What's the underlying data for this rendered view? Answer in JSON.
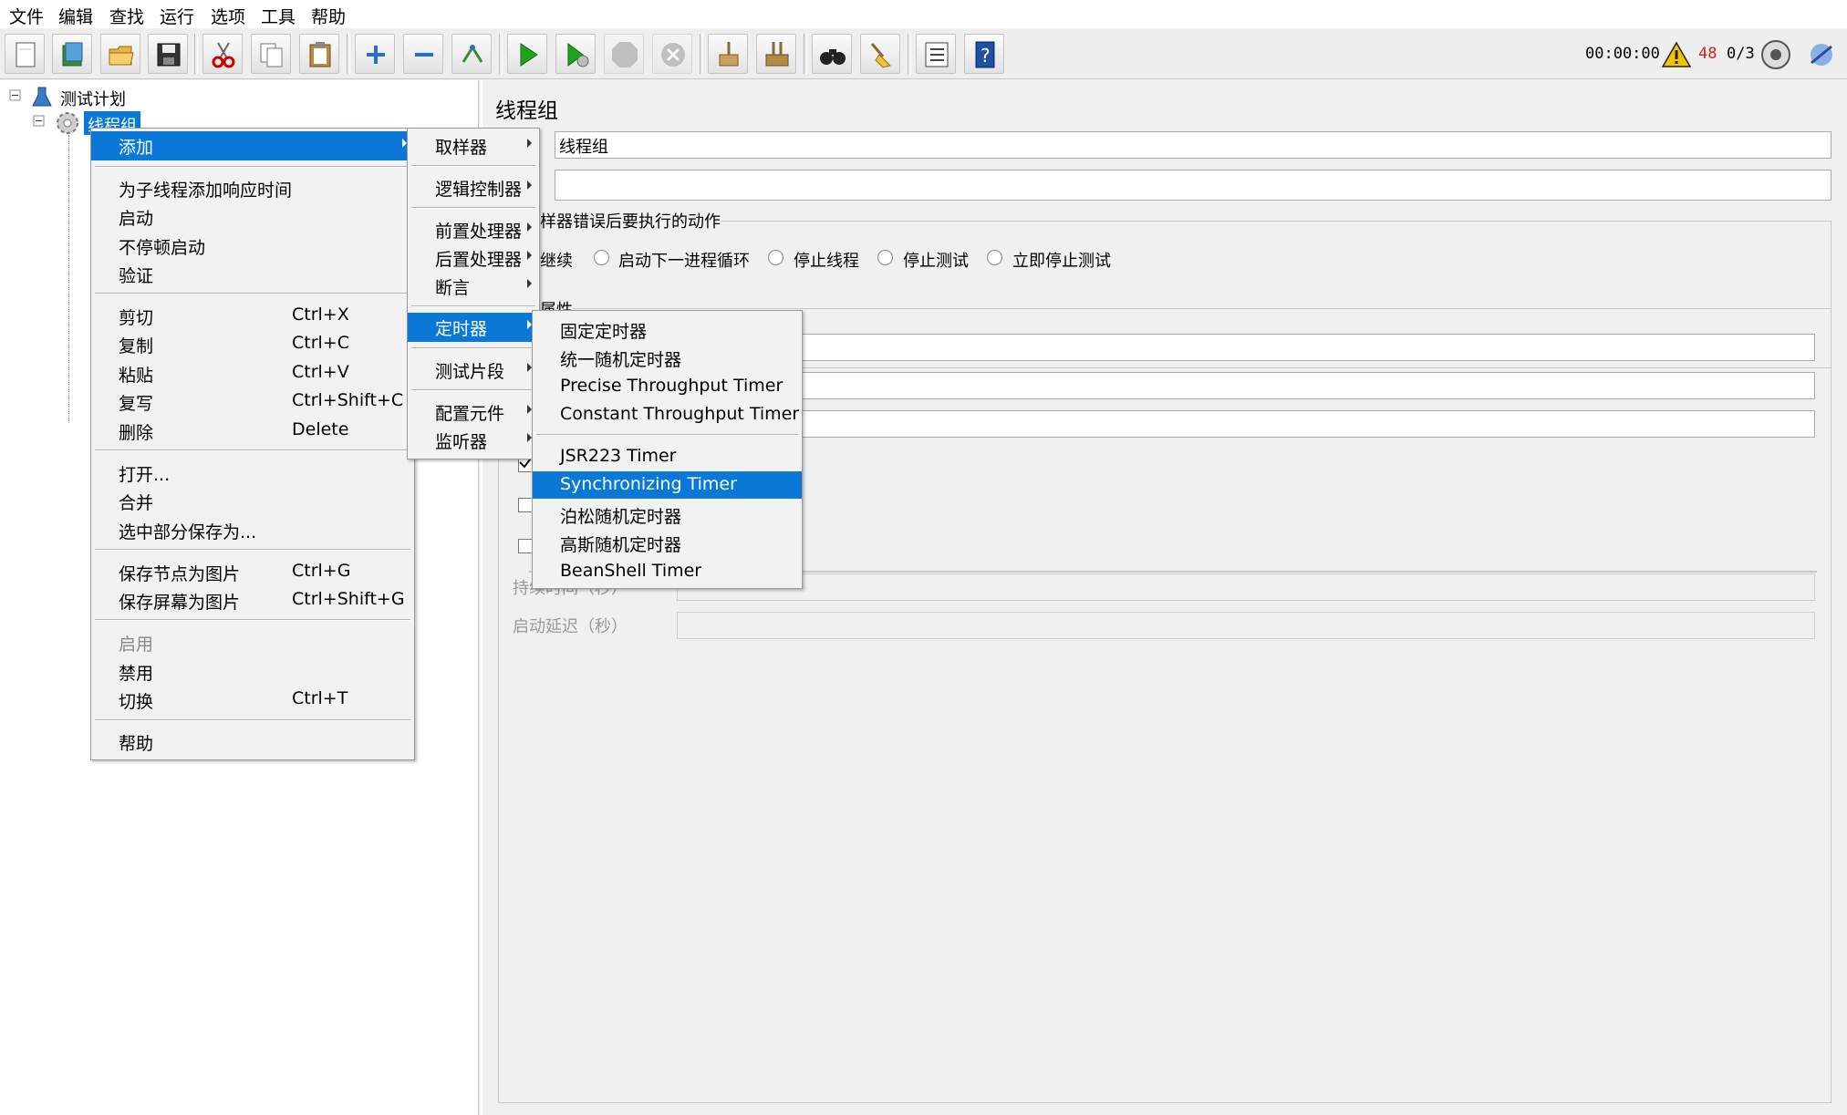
{
  "menubar": [
    "文件",
    "编辑",
    "查找",
    "运行",
    "选项",
    "工具",
    "帮助"
  ],
  "toolbar": {
    "timer": "00:00:00",
    "warning_count": "48",
    "threads": "0/3"
  },
  "tree": {
    "root": "测试计划",
    "thread_group": "线程组"
  },
  "panel": {
    "title": "线程组",
    "name_value": "线程组",
    "comment_value": "",
    "error_action_label": "样器错误后要执行的动作",
    "radio_continue": "继续",
    "radio_next_loop": "启动下一进程循环",
    "radio_stop_thread": "停止线程",
    "radio_stop_test": "停止测试",
    "radio_stop_now": "立即停止测试",
    "props_label": "属性",
    "duration_label": "持续时间（秒）",
    "delay_label": "启动延迟（秒）"
  },
  "context_menu": {
    "add": "添加",
    "add_response_time": "为子线程添加响应时间",
    "start": "启动",
    "start_no_pause": "不停顿启动",
    "validate": "验证",
    "cut": "剪切",
    "cut_sc": "Ctrl+X",
    "copy": "复制",
    "copy_sc": "Ctrl+C",
    "paste": "粘贴",
    "paste_sc": "Ctrl+V",
    "duplicate": "复写",
    "duplicate_sc": "Ctrl+Shift+C",
    "delete": "删除",
    "delete_sc": "Delete",
    "open": "打开...",
    "merge": "合并",
    "save_selection": "选中部分保存为...",
    "save_node_image": "保存节点为图片",
    "save_node_image_sc": "Ctrl+G",
    "save_screen_image": "保存屏幕为图片",
    "save_screen_image_sc": "Ctrl+Shift+G",
    "enable": "启用",
    "disable": "禁用",
    "toggle": "切换",
    "toggle_sc": "Ctrl+T",
    "help": "帮助"
  },
  "add_menu": {
    "sampler": "取样器",
    "logic_controller": "逻辑控制器",
    "pre_processor": "前置处理器",
    "post_processor": "后置处理器",
    "assertion": "断言",
    "timer": "定时器",
    "test_fragment": "测试片段",
    "config_element": "配置元件",
    "listener": "监听器"
  },
  "timer_menu": {
    "constant": "固定定时器",
    "uniform_random": "统一随机定时器",
    "precise_throughput": "Precise Throughput Timer",
    "constant_throughput": "Constant Throughput Timer",
    "jsr223": "JSR223 Timer",
    "synchronizing": "Synchronizing Timer",
    "poisson": "泊松随机定时器",
    "gaussian": "高斯随机定时器",
    "beanshell": "BeanShell Timer"
  },
  "colors": {
    "selection": "#0a78d7",
    "warning": "#e8b800",
    "warning_count": "#d02020"
  }
}
